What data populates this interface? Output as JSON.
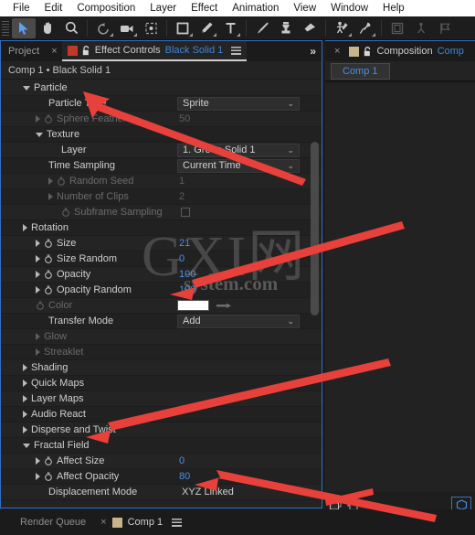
{
  "menubar": {
    "items": [
      "File",
      "Edit",
      "Composition",
      "Layer",
      "Effect",
      "Animation",
      "View",
      "Window",
      "Help"
    ]
  },
  "toolbar": {
    "tools": [
      {
        "name": "selection-tool",
        "icon": "arrow-cursor-icon",
        "active": true
      },
      {
        "name": "hand-tool",
        "icon": "hand-icon",
        "active": false
      },
      {
        "name": "zoom-tool",
        "icon": "magnifier-icon",
        "active": false
      },
      {
        "name": "rotation-tool",
        "icon": "rotate-icon",
        "active": false
      },
      {
        "name": "camera-tool",
        "icon": "camera-icon",
        "active": false
      },
      {
        "name": "pan-behind-tool",
        "icon": "anchor-point-icon",
        "active": false
      },
      {
        "name": "shape-tool",
        "icon": "rectangle-icon",
        "active": false
      },
      {
        "name": "pen-tool",
        "icon": "pen-icon",
        "active": false
      },
      {
        "name": "type-tool",
        "icon": "text-t-icon",
        "active": false
      },
      {
        "name": "brush-tool",
        "icon": "paintbrush-icon",
        "active": false
      },
      {
        "name": "clone-stamp-tool",
        "icon": "clone-stamp-icon",
        "active": false
      },
      {
        "name": "eraser-tool",
        "icon": "eraser-icon",
        "active": false
      },
      {
        "name": "roto-brush-tool",
        "icon": "roto-brush-icon",
        "active": false
      },
      {
        "name": "puppet-pin-tool",
        "icon": "pushpin-icon",
        "active": false
      },
      {
        "name": "workspace-1",
        "icon": "panel-layout-icon",
        "active": false
      },
      {
        "name": "workspace-2",
        "icon": "person-node-icon",
        "active": false
      },
      {
        "name": "workspace-3",
        "icon": "flag-icon",
        "active": false
      }
    ]
  },
  "effect_controls": {
    "tab_project": "Project",
    "tab_close": "×",
    "tab_label": "Effect Controls",
    "tab_target": "Black Solid 1",
    "overflow": "»",
    "breadcrumb": "Comp 1 • Black Solid 1",
    "rows": [
      {
        "label": "Particle",
        "indent": 0,
        "twirl": "down",
        "stopwatch": false,
        "dim": false,
        "value": null,
        "kind": "group"
      },
      {
        "label": "Particle Type",
        "indent": 2,
        "twirl": "none",
        "stopwatch": false,
        "dim": false,
        "value": "Sprite",
        "kind": "dropdown"
      },
      {
        "label": "Sphere Feather",
        "indent": 1,
        "twirl": "right",
        "stopwatch": true,
        "dim": true,
        "value": "50",
        "kind": "number"
      },
      {
        "label": "Texture",
        "indent": 1,
        "twirl": "down",
        "stopwatch": false,
        "dim": false,
        "value": null,
        "kind": "group"
      },
      {
        "label": "Layer",
        "indent": 3,
        "twirl": "none",
        "stopwatch": false,
        "dim": false,
        "value": "1. Green Solid 1",
        "kind": "dropdown"
      },
      {
        "label": "Time Sampling",
        "indent": 2,
        "twirl": "none",
        "stopwatch": false,
        "dim": false,
        "value": "Current Time",
        "kind": "dropdown"
      },
      {
        "label": "Random Seed",
        "indent": 2,
        "twirl": "right",
        "stopwatch": true,
        "dim": true,
        "value": "1",
        "kind": "number"
      },
      {
        "label": "Number of Clips",
        "indent": 2,
        "twirl": "right",
        "stopwatch": false,
        "dim": true,
        "value": "2",
        "kind": "number"
      },
      {
        "label": "Subframe Sampling",
        "indent": 3,
        "twirl": "none",
        "stopwatch": true,
        "dim": true,
        "value": null,
        "kind": "checkbox"
      },
      {
        "label": "Rotation",
        "indent": 0,
        "twirl": "right",
        "stopwatch": false,
        "dim": false,
        "value": null,
        "kind": "group"
      },
      {
        "label": "Size",
        "indent": 1,
        "twirl": "right",
        "stopwatch": true,
        "dim": false,
        "value": "21",
        "kind": "number"
      },
      {
        "label": "Size Random",
        "indent": 1,
        "twirl": "right",
        "stopwatch": true,
        "dim": false,
        "value": "0",
        "kind": "number"
      },
      {
        "label": "Opacity",
        "indent": 1,
        "twirl": "right",
        "stopwatch": true,
        "dim": false,
        "value": "100",
        "kind": "number"
      },
      {
        "label": "Opacity Random",
        "indent": 1,
        "twirl": "right",
        "stopwatch": true,
        "dim": false,
        "value": "100",
        "kind": "number"
      },
      {
        "label": "Color",
        "indent": 1,
        "twirl": "none",
        "stopwatch": true,
        "dim": true,
        "value": "#FFFFFF",
        "kind": "color"
      },
      {
        "label": "Transfer Mode",
        "indent": 2,
        "twirl": "none",
        "stopwatch": false,
        "dim": false,
        "value": "Add",
        "kind": "dropdown"
      },
      {
        "label": "Glow",
        "indent": 1,
        "twirl": "right",
        "stopwatch": false,
        "dim": true,
        "value": null,
        "kind": "group"
      },
      {
        "label": "Streaklet",
        "indent": 1,
        "twirl": "right",
        "stopwatch": false,
        "dim": true,
        "value": null,
        "kind": "group"
      },
      {
        "label": "Shading",
        "indent": 0,
        "twirl": "right",
        "stopwatch": false,
        "dim": false,
        "value": null,
        "kind": "group"
      },
      {
        "label": "Quick Maps",
        "indent": 0,
        "twirl": "right",
        "stopwatch": false,
        "dim": false,
        "value": null,
        "kind": "group"
      },
      {
        "label": "Layer Maps",
        "indent": 0,
        "twirl": "right",
        "stopwatch": false,
        "dim": false,
        "value": null,
        "kind": "group"
      },
      {
        "label": "Audio React",
        "indent": 0,
        "twirl": "right",
        "stopwatch": false,
        "dim": false,
        "value": null,
        "kind": "group"
      },
      {
        "label": "Disperse and Twist",
        "indent": 0,
        "twirl": "right",
        "stopwatch": false,
        "dim": false,
        "value": null,
        "kind": "group"
      },
      {
        "label": "Fractal Field",
        "indent": 0,
        "twirl": "down",
        "stopwatch": false,
        "dim": false,
        "value": null,
        "kind": "group"
      },
      {
        "label": "Affect Size",
        "indent": 1,
        "twirl": "right",
        "stopwatch": true,
        "dim": false,
        "value": "0",
        "kind": "number"
      },
      {
        "label": "Affect Opacity",
        "indent": 1,
        "twirl": "right",
        "stopwatch": true,
        "dim": false,
        "value": "80",
        "kind": "number"
      },
      {
        "label": "Displacement Mode",
        "indent": 2,
        "twirl": "none",
        "stopwatch": false,
        "dim": false,
        "value": "XYZ Linked",
        "kind": "plain"
      }
    ]
  },
  "composition_panel": {
    "tab_close": "×",
    "tab_label": "Composition",
    "tab_target": "Comp",
    "chip": "Comp 1"
  },
  "bottom_bar": {
    "render_queue": "Render Queue",
    "close": "×",
    "active_tab": "Comp 1"
  },
  "watermark": {
    "big": "GXI网",
    "small": "system.com"
  },
  "colors": {
    "accent_blue": "#4a90e2",
    "panel_border": "#2f6fc4",
    "arrow_red": "#e8403a",
    "panel_bg": "#232323",
    "menubar_bg": "#ffffff"
  }
}
